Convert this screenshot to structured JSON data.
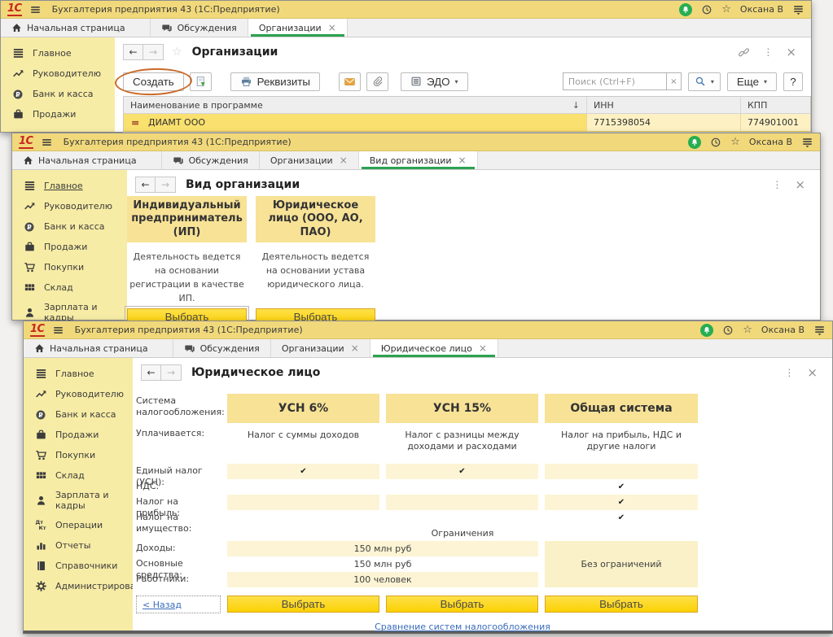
{
  "app": {
    "logo": "1С",
    "title": "Бухгалтерия предприятия 43  (1С:Предприятие)",
    "user": "Оксана В"
  },
  "glyphs": {
    "close": "×",
    "check": "✔",
    "dots": "⋮",
    "back": "←",
    "forward": "→",
    "sort_down": "↓",
    "star": "☆",
    "caret": "▾"
  },
  "colors": {
    "titlebar_yellow": "#f1d97b",
    "sidebar_yellow": "#f7eca5",
    "card_yellow": "#f7e296",
    "stripe_yellow": "#fcf4d4",
    "button_yellow": "#fbd103",
    "active_tab_green": "#2ca24f",
    "link_blue": "#3a6cbc",
    "selected_row_yellow": "#fae06e",
    "annotation_orange": "#c96a2a"
  },
  "tabs": {
    "home": "Начальная страница",
    "discussions": "Обсуждения",
    "organizations": "Организации",
    "org_kind": "Вид организации",
    "legal_entity": "Юридическое лицо"
  },
  "win_orgs": {
    "title": "Организации",
    "sidebar": [
      "Главное",
      "Руководителю",
      "Банк и касса",
      "Продажи"
    ],
    "toolbar": {
      "create": "Создать",
      "requisites": "Реквизиты",
      "edo": "ЭДО",
      "search_placeholder": "Поиск (Ctrl+F)",
      "more": "Еще",
      "help": "?"
    },
    "table": {
      "col_name": "Наименование в программе",
      "col_inn": "ИНН",
      "col_kpp": "КПП",
      "row": {
        "name": "ДИАМТ ООО",
        "inn": "7715398054",
        "kpp": "774901001"
      }
    }
  },
  "win_kind": {
    "title": "Вид организации",
    "sidebar": [
      "Главное",
      "Руководителю",
      "Банк и касса",
      "Продажи",
      "Покупки",
      "Склад",
      "Зарплата и кадры"
    ],
    "cards": [
      {
        "title": "Индивидуальный предприниматель (ИП)",
        "desc": "Деятельность ведется на основании регистрации в качестве ИП.",
        "button": "Выбрать"
      },
      {
        "title": "Юридическое лицо (ООО, АО, ПАО)",
        "desc": "Деятельность ведется на основании устава юридического лица.",
        "button": "Выбрать"
      }
    ]
  },
  "win_legal": {
    "title": "Юридическое лицо",
    "sidebar": [
      "Главное",
      "Руководителю",
      "Банк и касса",
      "Продажи",
      "Покупки",
      "Склад",
      "Зарплата и кадры",
      "Операции",
      "Отчеты",
      "Справочники",
      "Администрирование"
    ],
    "compare": {
      "labels": {
        "system": "Система налогообложения:",
        "paid": "Уплачивается:",
        "usn": "Единый налог (УСН):",
        "vat": "НДС:",
        "profit": "Налог на прибыль:",
        "property": "Налог на имущество:",
        "income": "Доходы:",
        "assets": "Основные средства:",
        "employees": "Работники:"
      },
      "systems": [
        "УСН 6%",
        "УСН 15%",
        "Общая система"
      ],
      "paid_values": [
        "Налог с суммы доходов",
        "Налог с разницы между доходами и расходами",
        "Налог на прибыль, НДС и другие налоги"
      ],
      "limits_title": "Ограничения",
      "income_value": "150 млн руб",
      "assets_value": "150 млн руб",
      "employees_value": "100 человек",
      "no_limits": "Без ограничений",
      "back_link": "< Назад",
      "select_button": "Выбрать",
      "compare_link": "Сравнение систем налогообложения"
    }
  }
}
